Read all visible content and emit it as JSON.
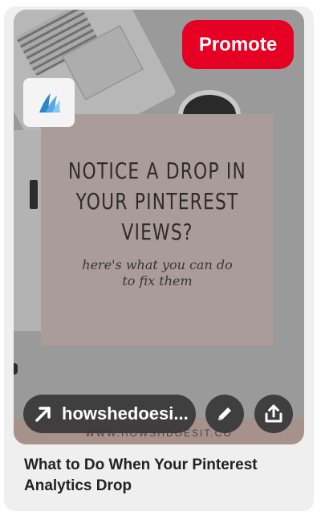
{
  "pin": {
    "promote_label": "Promote",
    "headline": "NOTICE A DROP IN\nYOUR PINTEREST\nVIEWS?",
    "subline": "here's what you can do\nto fix them",
    "watermark": "WWW.HOWSHDOESIT.CO",
    "link_label": "howshedoesi...",
    "title": "What to Do When Your Pinterest Analytics Drop"
  },
  "icons": {
    "logo": "stylized-wing-logo",
    "link": "arrow-up-right-icon",
    "edit": "pencil-icon",
    "share": "share-upload-icon"
  },
  "colors": {
    "promote_bg": "#e60023",
    "card_bg": "#efefef",
    "text_card_bg": "#aa9d99",
    "overlay_button_bg": "#373737"
  }
}
